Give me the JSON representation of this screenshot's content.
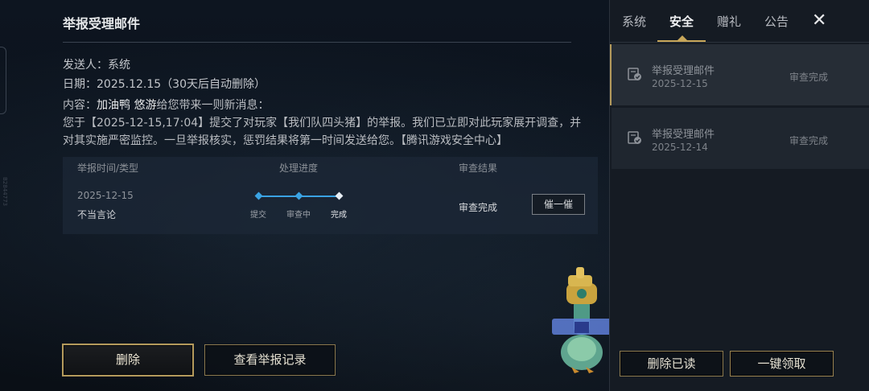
{
  "side_code": "B2844773",
  "mail": {
    "title": "举报受理邮件",
    "sender": "发送人：系统",
    "date": "日期：2025.12.15（30天后自动删除）",
    "content_prefix": "内容：",
    "content_user": "加油鸭 悠游",
    "content_rest": "给您带来一则新消息：",
    "content_body": "您于【2025-12-15,17:04】提交了对玩家【我们队四头猪】的举报。我们已立即对此玩家展开调查，并对其实施严密监控。一旦举报核实，惩罚结果将第一时间发送给您。【腾讯游戏安全中心】"
  },
  "table": {
    "headers": [
      "举报时间/类型",
      "处理进度",
      "审查结果"
    ],
    "row": {
      "date": "2025-12-15",
      "type": "不当言论",
      "steps": [
        "提交",
        "审查中",
        "完成"
      ],
      "result": "审查完成",
      "urge_label": "催一催"
    }
  },
  "buttons": {
    "delete": "删除",
    "view_records": "查看举报记录",
    "delete_read": "删除已读",
    "claim_all": "一键领取"
  },
  "tabs": [
    "系统",
    "安全",
    "赠礼",
    "公告"
  ],
  "active_tab": "安全",
  "mail_list": [
    {
      "title": "举报受理邮件",
      "date": "2025-12-15",
      "status": "审查完成"
    },
    {
      "title": "举报受理邮件",
      "date": "2025-12-14",
      "status": "审查完成"
    }
  ],
  "colors": {
    "accent_gold": "#b49a5c",
    "progress_blue": "#3aa3e3"
  }
}
